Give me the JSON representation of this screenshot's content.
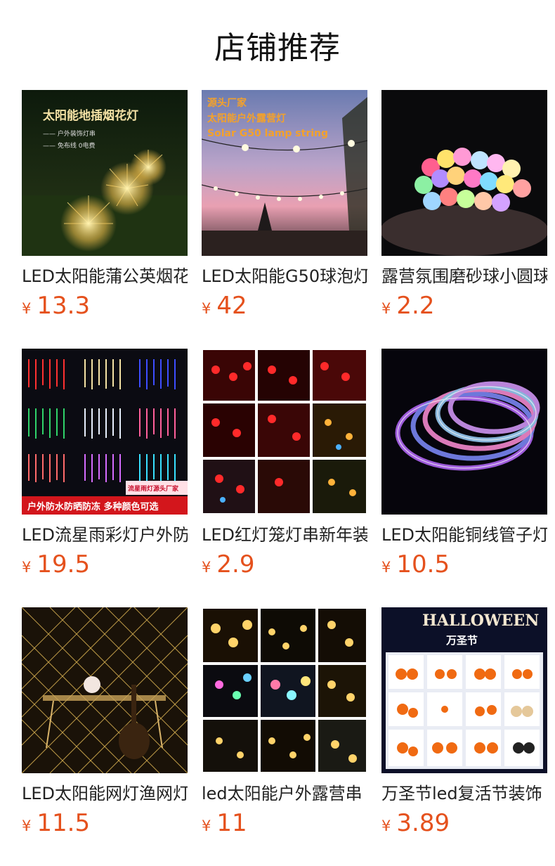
{
  "header": {
    "title": "店铺推荐"
  },
  "products": [
    {
      "title": "LED太阳能蒲公英烟花",
      "currency": "¥",
      "price": "13.3",
      "image_text": {
        "headline": "太阳能地插烟花灯",
        "line1": "—— 户外装饰灯串",
        "line2": "—— 免布线 0电费"
      }
    },
    {
      "title": "LED太阳能G50球泡灯",
      "currency": "¥",
      "price": "42",
      "image_text": {
        "line1": "源头厂家",
        "line2": "太阳能户外露营灯",
        "line3": "Solar G50 lamp string"
      }
    },
    {
      "title": "露营氛围磨砂球小圆球",
      "currency": "¥",
      "price": "2.2"
    },
    {
      "title": "LED流星雨彩灯户外防",
      "currency": "¥",
      "price": "19.5",
      "image_text": {
        "banner": "户外防水防晒防冻 多种颜色可选",
        "tag": "流星雨灯源头厂家"
      }
    },
    {
      "title": "LED红灯笼灯串新年装",
      "currency": "¥",
      "price": "2.9"
    },
    {
      "title": "LED太阳能铜线管子灯",
      "currency": "¥",
      "price": "10.5"
    },
    {
      "title": "LED太阳能网灯渔网灯",
      "currency": "¥",
      "price": "11.5"
    },
    {
      "title": "led太阳能户外露营串",
      "currency": "¥",
      "price": "11"
    },
    {
      "title": "万圣节led复活节装饰",
      "currency": "¥",
      "price": "3.89",
      "image_text": {
        "line1": "HALLOWEEN",
        "line2": "万圣节"
      }
    }
  ]
}
